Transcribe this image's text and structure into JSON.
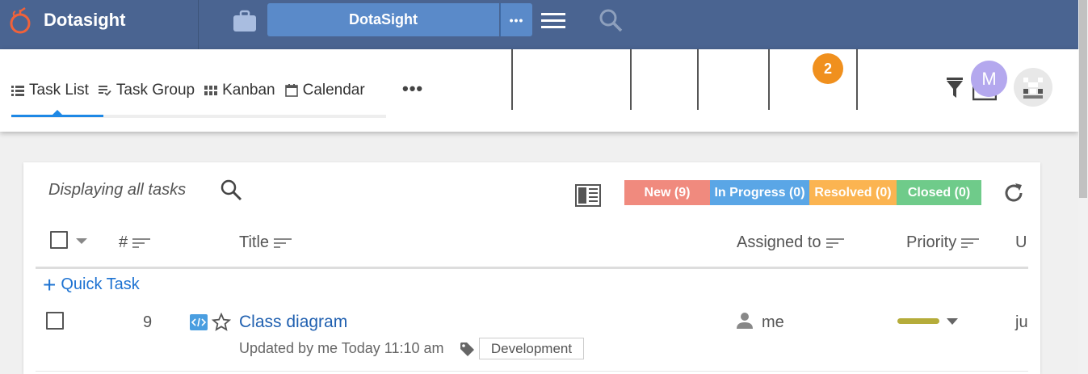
{
  "app": {
    "brand": "Dotasight",
    "project": "DotaSight",
    "project_more": "•••"
  },
  "tabs": [
    {
      "label": "Task List",
      "icon": "list-icon",
      "active": true
    },
    {
      "label": "Task Group",
      "icon": "playlist-check-icon",
      "active": false
    },
    {
      "label": "Kanban",
      "icon": "grid-icon",
      "active": false
    },
    {
      "label": "Calendar",
      "icon": "calendar-icon",
      "active": false
    }
  ],
  "tabs_more": "•••",
  "notification_count": "2",
  "user": {
    "avatar_letter": "M"
  },
  "card": {
    "display_text": "Displaying all tasks",
    "statuses": [
      {
        "label": "New (9)",
        "color": "#f08a7e"
      },
      {
        "label": "In Progress (0)",
        "color": "#5aa6e6"
      },
      {
        "label": "Resolved (0)",
        "color": "#fbb451"
      },
      {
        "label": "Closed (0)",
        "color": "#6fcb8a"
      }
    ],
    "columns": {
      "number": "#",
      "title": "Title",
      "assigned": "Assigned to",
      "priority": "Priority",
      "next": "U"
    },
    "quick_task": "Quick Task",
    "rows": [
      {
        "number": "9",
        "title": "Class diagram",
        "updated": "Updated by me Today 11:10 am",
        "tag": "Development",
        "assignee": "me",
        "priority_color": "#b5ac3a",
        "date_partial": "ju"
      }
    ]
  },
  "colors": {
    "topbar": "#4a6491",
    "accent": "#1e88e5",
    "badge": "#f0901e"
  }
}
